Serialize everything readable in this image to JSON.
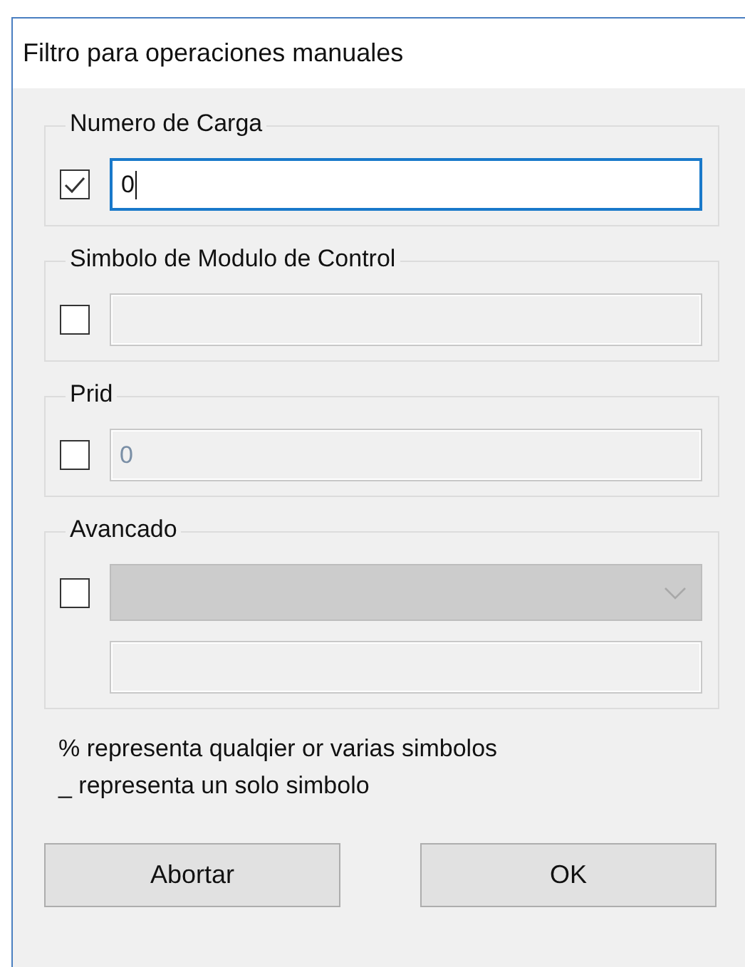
{
  "window": {
    "title": "Filtro para operaciones manuales"
  },
  "groups": [
    {
      "title": "Numero de Carga",
      "checked": true,
      "fields": [
        {
          "kind": "text",
          "value": "0",
          "disabled": false,
          "focused": true
        }
      ]
    },
    {
      "title": "Simbolo de Modulo de Control",
      "checked": false,
      "fields": [
        {
          "kind": "text",
          "disabled": true
        }
      ]
    },
    {
      "title": "Prid",
      "checked": false,
      "fields": [
        {
          "kind": "text",
          "value": "0",
          "disabled": true
        }
      ]
    },
    {
      "title": "Avancado",
      "checked": false,
      "fields": [
        {
          "kind": "combo",
          "disabled": true
        },
        {
          "kind": "text",
          "disabled": true
        }
      ]
    }
  ],
  "notes": [
    "% representa qualqier or varias simbolos",
    "_ representa un solo simbolo"
  ],
  "buttons": [
    "Abortar",
    "OK"
  ]
}
